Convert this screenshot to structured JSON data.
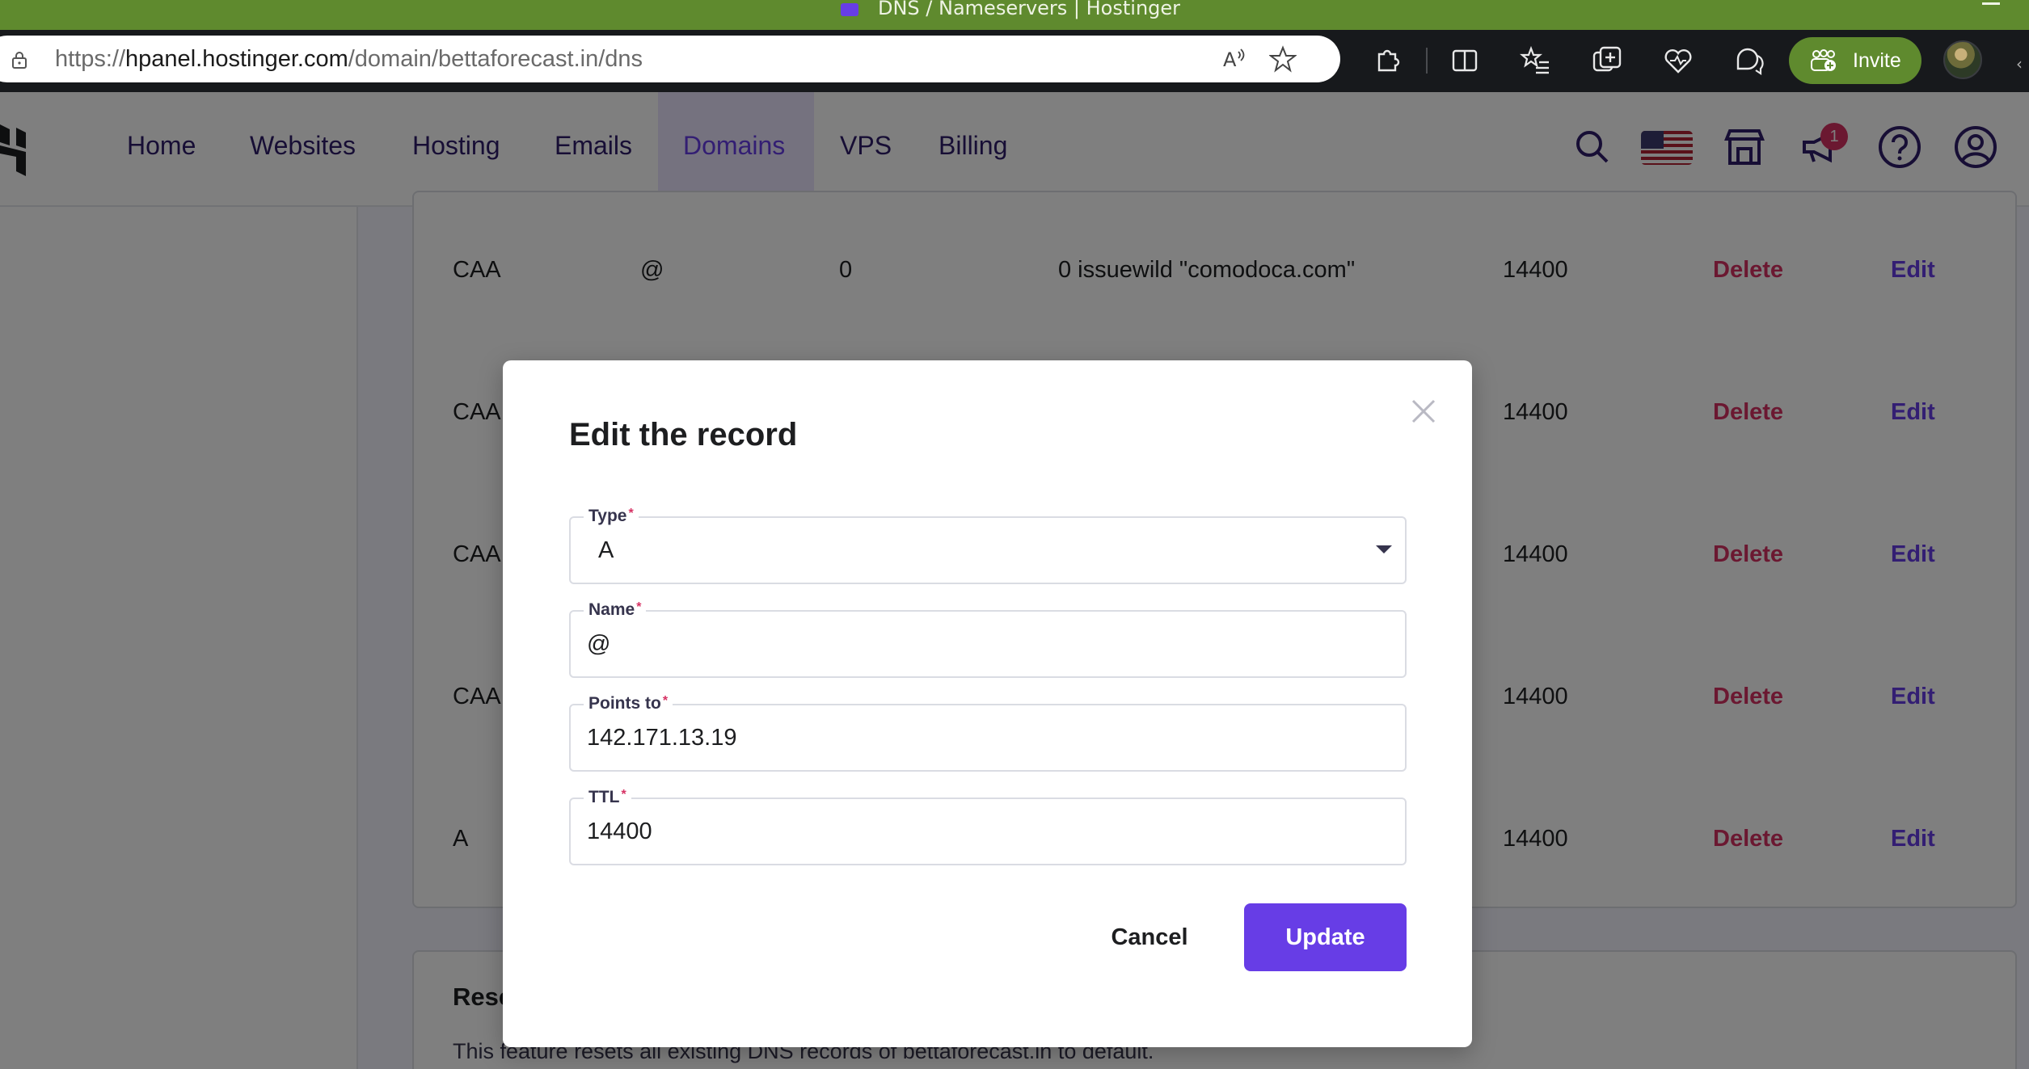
{
  "window": {
    "title": "DNS / Nameservers | Hostinger"
  },
  "browser": {
    "url_prefix": "https://",
    "url_host": "hpanel.hostinger.com",
    "url_path": "/domain/bettaforecast.in/dns",
    "invite_label": "Invite",
    "icons": [
      "lock-icon",
      "read-aloud-icon",
      "favorite-star-icon",
      "extensions-icon",
      "split-screen-icon",
      "favorites-icon",
      "collections-icon",
      "browser-essentials-icon",
      "copilot-icon"
    ]
  },
  "header": {
    "nav": [
      {
        "label": "Home"
      },
      {
        "label": "Websites"
      },
      {
        "label": "Hosting"
      },
      {
        "label": "Emails"
      },
      {
        "label": "Domains"
      },
      {
        "label": "VPS"
      },
      {
        "label": "Billing"
      }
    ],
    "active_nav": "Domains",
    "notification_count": "1",
    "icons": [
      "search-icon",
      "us-flag-icon",
      "store-icon",
      "megaphone-icon",
      "help-icon",
      "account-icon"
    ]
  },
  "records": [
    {
      "type": "CAA",
      "name": "@",
      "priority": "0",
      "content": "0 issuewild \"comodoca.com\"",
      "ttl": "14400",
      "delete": "Delete",
      "edit": "Edit"
    },
    {
      "type": "CAA",
      "ttl": "14400",
      "delete": "Delete",
      "edit": "Edit"
    },
    {
      "type": "CAA",
      "ttl": "14400",
      "delete": "Delete",
      "edit": "Edit"
    },
    {
      "type": "CAA",
      "ttl": "14400",
      "delete": "Delete",
      "edit": "Edit"
    },
    {
      "type": "A",
      "ttl": "14400",
      "delete": "Delete",
      "edit": "Edit"
    }
  ],
  "reset": {
    "title": "Rese",
    "description": "This feature resets all existing DNS records of bettaforecast.in to default."
  },
  "modal": {
    "title": "Edit the record",
    "fields": {
      "type": {
        "label": "Type",
        "value": "A"
      },
      "name": {
        "label": "Name",
        "value": "@"
      },
      "points_to": {
        "label": "Points to",
        "value": "142.171.13.19"
      },
      "ttl": {
        "label": "TTL",
        "value": "14400"
      }
    },
    "required_mark": "*",
    "cancel_label": "Cancel",
    "update_label": "Update"
  },
  "colors": {
    "accent": "#673de6",
    "danger": "#d63163",
    "title_bar": "#5f8a2e"
  }
}
